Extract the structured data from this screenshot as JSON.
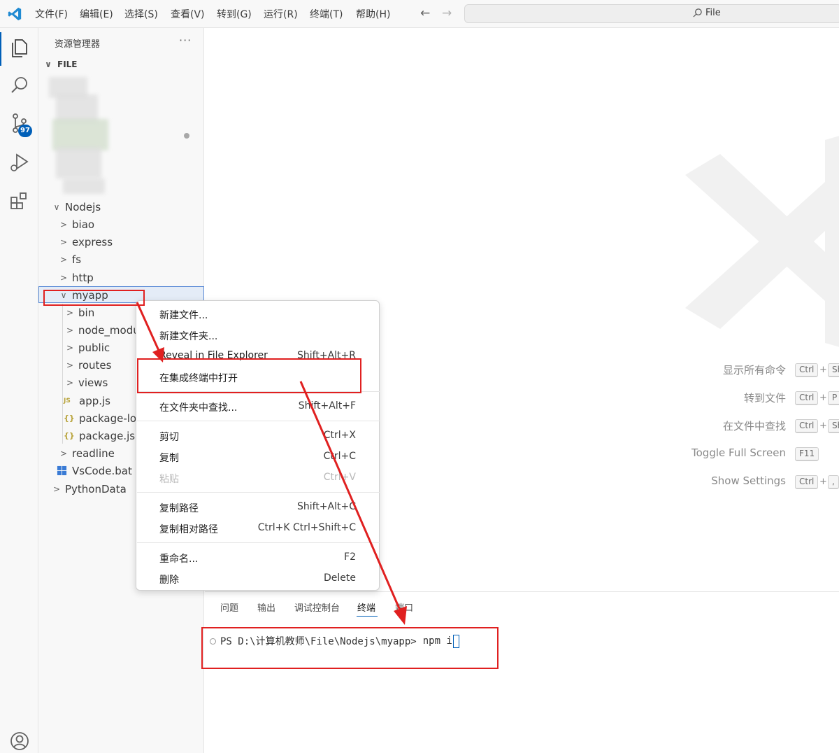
{
  "menubar": {
    "items": [
      "文件(F)",
      "编辑(E)",
      "选择(S)",
      "查看(V)",
      "转到(G)",
      "运行(R)",
      "终端(T)",
      "帮助(H)"
    ],
    "back_arrow": "←",
    "forward_arrow": "→",
    "search_text": "File"
  },
  "activitybar": {
    "icons": [
      "explorer-icon",
      "search-icon",
      "source-control-icon",
      "run-debug-icon",
      "extensions-icon",
      "account-icon"
    ],
    "scm_badge": "97",
    "accent": "#005fb8"
  },
  "sidebar": {
    "title": "资源管理器",
    "more": "···",
    "section": "FILE",
    "tree": [
      {
        "label": "Nodejs",
        "chevron": "∨"
      },
      {
        "label": "biao",
        "chevron": ">"
      },
      {
        "label": "express",
        "chevron": ">"
      },
      {
        "label": "fs",
        "chevron": ">"
      },
      {
        "label": "http",
        "chevron": ">"
      },
      {
        "label": "myapp",
        "chevron": "∨"
      },
      {
        "label": "bin",
        "chevron": ">"
      },
      {
        "label": "node_modul",
        "chevron": ">"
      },
      {
        "label": "public",
        "chevron": ">"
      },
      {
        "label": "routes",
        "chevron": ">"
      },
      {
        "label": "views",
        "chevron": ">"
      },
      {
        "label": "app.js",
        "icon_text": "JS"
      },
      {
        "label": "package-loc",
        "icon_text": "{}"
      },
      {
        "label": "package.jsor",
        "icon_text": "{}"
      },
      {
        "label": "readline",
        "chevron": ">"
      },
      {
        "label": "VsCode.bat",
        "icon": "windows-icon"
      },
      {
        "label": "PythonData",
        "chevron": ">"
      }
    ]
  },
  "context_menu": {
    "items": [
      {
        "label": "新建文件...",
        "key": ""
      },
      {
        "label": "新建文件夹...",
        "key": ""
      },
      {
        "label": "Reveal in File Explorer",
        "key": "Shift+Alt+R"
      },
      {
        "label": "在集成终端中打开",
        "key": ""
      },
      {
        "label": "在文件夹中查找...",
        "key": "Shift+Alt+F"
      },
      {
        "label": "剪切",
        "key": "Ctrl+X"
      },
      {
        "label": "复制",
        "key": "Ctrl+C"
      },
      {
        "label": "粘贴",
        "key": "Ctrl+V",
        "disabled": true
      },
      {
        "label": "复制路径",
        "key": "Shift+Alt+C"
      },
      {
        "label": "复制相对路径",
        "key": "Ctrl+K Ctrl+Shift+C"
      },
      {
        "label": "重命名...",
        "key": "F2"
      },
      {
        "label": "删除",
        "key": "Delete"
      }
    ]
  },
  "shortcuts": [
    {
      "label": "显示所有命令",
      "keys": [
        "Ctrl",
        "+",
        "Sh"
      ]
    },
    {
      "label": "转到文件",
      "keys": [
        "Ctrl",
        "+",
        "P"
      ]
    },
    {
      "label": "在文件中查找",
      "keys": [
        "Ctrl",
        "+",
        "Sh"
      ]
    },
    {
      "label": "Toggle Full Screen",
      "keys": [
        "F11"
      ]
    },
    {
      "label": "Show Settings",
      "keys": [
        "Ctrl",
        "+",
        ","
      ]
    }
  ],
  "panel": {
    "tabs": [
      "问题",
      "输出",
      "调试控制台",
      "终端",
      "端口"
    ],
    "active_tab": "终端",
    "terminal_prompt": "PS D:\\计算机教师\\File\\Nodejs\\myapp>",
    "terminal_command": "npm i"
  },
  "annotation_color": "#e02020"
}
